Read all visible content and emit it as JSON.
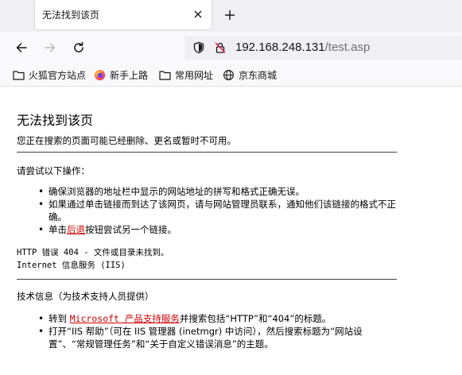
{
  "tab": {
    "title": "无法找到该页"
  },
  "address": {
    "host": "192.168.248.131",
    "path": "/test.asp"
  },
  "bookmarks": [
    {
      "label": "火狐官方站点",
      "icon": "folder-icon"
    },
    {
      "label": "新手上路",
      "icon": "firefox-icon"
    },
    {
      "label": "常用网址",
      "icon": "folder-icon"
    },
    {
      "label": "京东商城",
      "icon": "globe-icon"
    }
  ],
  "page": {
    "title": "无法找到该页",
    "subtitle": "您正在搜索的页面可能已经删除、更名或暂时不可用。",
    "try_heading": "请尝试以下操作：",
    "try_items": {
      "item1": "确保浏览器的地址栏中显示的网站地址的拼写和格式正确无误。",
      "item2": "如果通过单击链接而到达了该网页，请与网站管理员联系，通知他们该链接的格式不正确。",
      "item3_pre": "单击",
      "item3_link": "后退",
      "item3_post": "按钮尝试另一个链接。"
    },
    "error_line1": "HTTP 错误 404 - 文件或目录未找到。",
    "error_line2": "Internet 信息服务 (IIS)",
    "tech_heading": "技术信息（为技术支持人员提供）",
    "tech_items": {
      "item1_pre": "转到 ",
      "item1_link": "Microsoft 产品支持服务",
      "item1_post": "并搜索包括“HTTP”和“404”的标题。",
      "item2": "打开“IIS 帮助”（可在 IIS 管理器 (inetmgr) 中访问），然后搜索标题为“网站设置”、“常规管理任务”和“关于自定义错误消息”的主题。"
    }
  },
  "colors": {
    "link": "#cc0000",
    "toolbar": "#f9f9fb",
    "tabstrip": "#f0f0f4"
  }
}
